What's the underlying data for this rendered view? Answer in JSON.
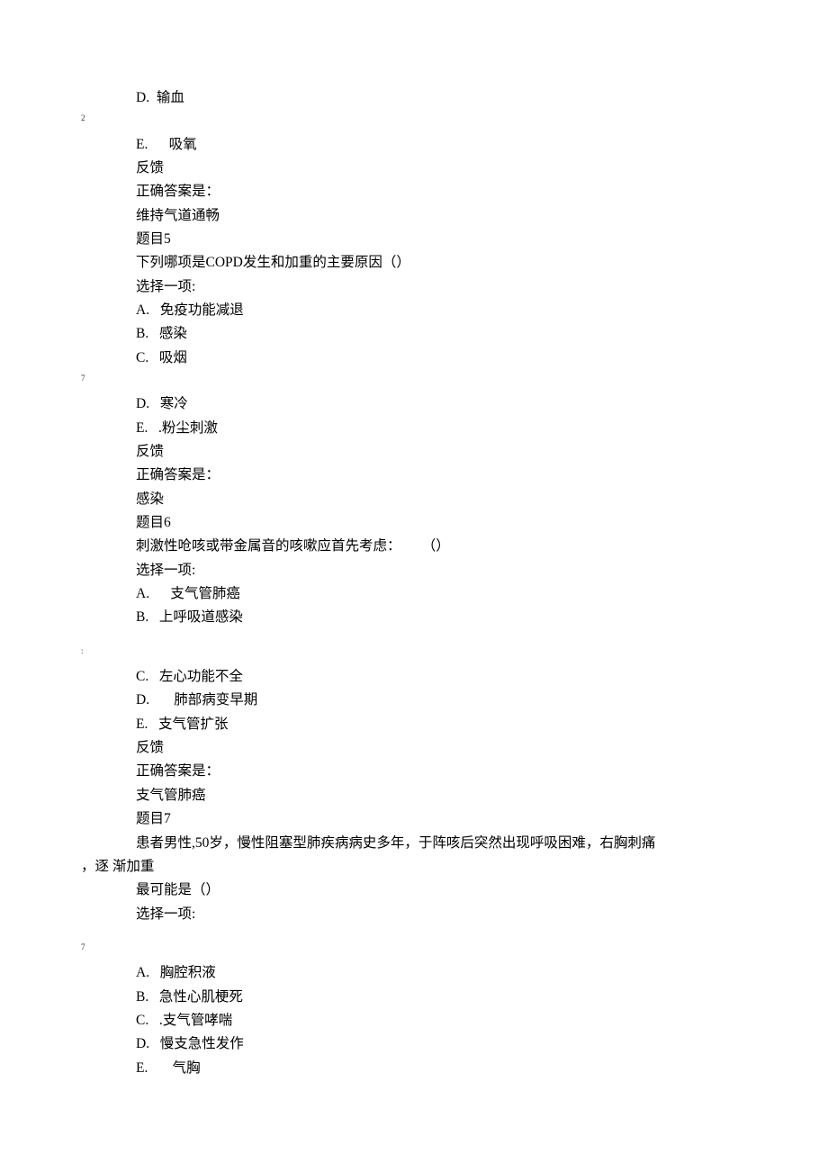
{
  "page": {
    "q4": {
      "option_d": "D.  输血",
      "marker2": "2",
      "option_e": "E.      吸氧",
      "feedback_label": "反馈",
      "correct_label": "正确答案是：",
      "correct": "维持气道通畅"
    },
    "q5": {
      "title": "题目5",
      "stem": "下列哪项是COPD发生和加重的主要原因（）",
      "select": "选择一项:",
      "option_a": "A.   免疫功能减退",
      "option_b": "B.   感染",
      "option_c": "C.   吸烟",
      "marker7a": "7",
      "option_d": "D.   寒冷",
      "option_e": "E.   .粉尘刺激",
      "feedback_label": "反馈",
      "correct_label": "正确答案是：",
      "correct": "感染"
    },
    "q6": {
      "title": "题目6",
      "stem": "刺激性呛咳或带金属音的咳嗽应首先考虑：      （）",
      "select": "选择一项:",
      "option_a": "A.      支气管肺癌",
      "option_b": "B.   上呼吸道感染",
      "marker1": ":",
      "option_c": "C.   左心功能不全",
      "option_d": "D.       肺部病变早期",
      "option_e": "E.   支气管扩张",
      "feedback_label": "反馈",
      "correct_label": "正确答案是：",
      "correct": "支气管肺癌"
    },
    "q7": {
      "title": "题目7",
      "stem_line1": "患者男性,50岁，慢性阻塞型肺疾病病史多年，于阵咳后突然出现呼吸困难，右胸刺痛",
      "stem_line2": "，逐 渐加重",
      "stem_line3": "最可能是（）",
      "select": "选择一项:",
      "marker7b": "7",
      "option_a": "A.   胸腔积液",
      "option_b": "B.   急性心肌梗死",
      "option_c": "C.   .支气管哮喘",
      "option_d": "D.   慢支急性发作",
      "option_e": "E.       气胸"
    }
  }
}
